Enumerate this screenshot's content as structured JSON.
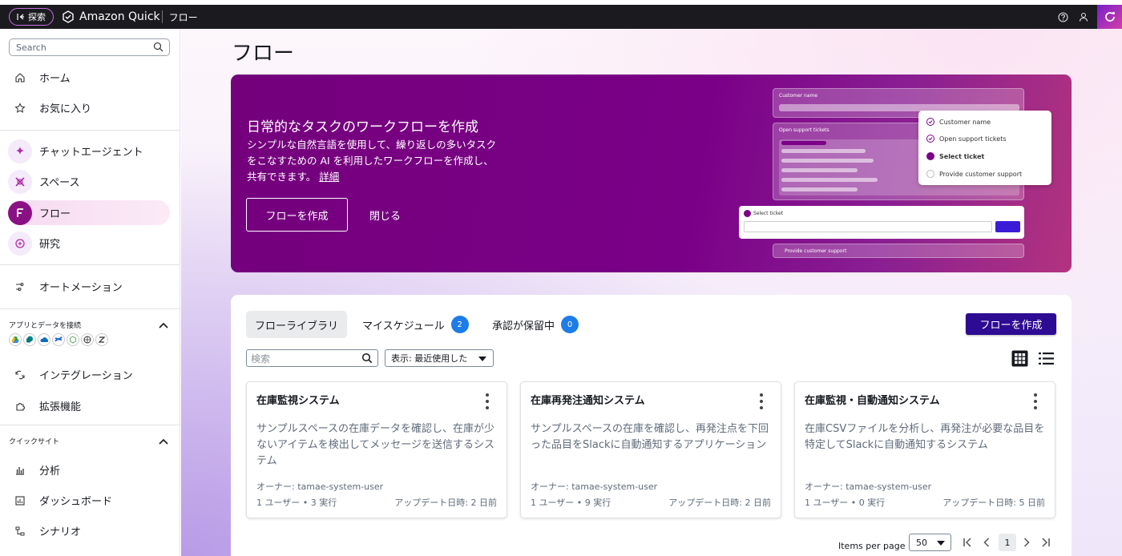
{
  "topbar": {
    "explore_label": "探索",
    "brand": "Amazon Quick",
    "breadcrumb": "フロー"
  },
  "sidebar": {
    "search_placeholder": "Search",
    "items": [
      {
        "label": "ホーム",
        "icon": "home-icon"
      },
      {
        "label": "お気に入り",
        "icon": "star-icon"
      },
      {
        "label": "チャットエージェント",
        "icon": "sparkle-icon"
      },
      {
        "label": "スペース",
        "icon": "spaces-icon"
      },
      {
        "label": "フロー",
        "icon": "flows-icon",
        "active": true
      },
      {
        "label": "研究",
        "icon": "research-icon"
      },
      {
        "label": "オートメーション",
        "icon": "automation-icon"
      },
      {
        "label": "インテグレーション",
        "icon": "integration-icon"
      },
      {
        "label": "拡張機能",
        "icon": "extension-icon"
      },
      {
        "label": "分析",
        "icon": "analysis-icon"
      },
      {
        "label": "ダッシュボード",
        "icon": "dashboard-icon"
      },
      {
        "label": "シナリオ",
        "icon": "scenario-icon"
      }
    ],
    "section_connect": "アプリとデータを接続",
    "section_quicksight": "クイックサイト"
  },
  "main": {
    "page_title": "フロー",
    "banner": {
      "title": "日常的なタスクのワークフローを作成",
      "line1": "シンプルな自然言語を使用して、繰り返しの多いタスク",
      "line2": "をこなすための AI を利用したワークフローを作成し、",
      "line3": "共有できます。",
      "link": "詳細",
      "create_label": "フローを作成",
      "close_label": "閉じる",
      "illustration": {
        "customer_name": "Customer name",
        "open_tickets": "Open support tickets",
        "select_ticket": "Select ticket",
        "provide_support": "Provide customer support",
        "select_ticket_card": "Select ticket",
        "provide_support_card": "Provide customer support"
      }
    },
    "library": {
      "tabs": [
        {
          "label": "フローライブラリ"
        },
        {
          "label": "マイスケジュール",
          "badge": "2"
        },
        {
          "label": "承認が保留中",
          "badge": "0"
        }
      ],
      "create_label": "フローを作成",
      "search_placeholder": "検索",
      "sort_label": "表示: 最近使用した",
      "cards": [
        {
          "title": "在庫監視システム",
          "desc": "サンプルスペースの在庫データを確認し、在庫が少ないアイテムを検出してメッセージを送信するシステム",
          "owner": "オーナー: tamae-system-user",
          "stats": "1 ユーザー • 3 実行",
          "updated": "アップデート日時: 2 日前"
        },
        {
          "title": "在庫再発注通知システム",
          "desc": "サンプルスペースの在庫を確認し、再発注点を下回った品目をSlackに自動通知するアプリケーション",
          "owner": "オーナー: tamae-system-user",
          "stats": "1 ユーザー • 9 実行",
          "updated": "アップデート日時: 2 日前"
        },
        {
          "title": "在庫監視・自動通知システム",
          "desc": "在庫CSVファイルを分析し、再発注が必要な品目を特定してSlackに自動通知するシステム",
          "owner": "オーナー: tamae-system-user",
          "stats": "1 ユーザー • 0 実行",
          "updated": "アップデート日時: 5 日前"
        }
      ],
      "pager": {
        "label": "Items per page",
        "per_page": "50",
        "current_page": "1"
      }
    }
  },
  "colors": {
    "banner_purple": "#74007c",
    "create_button": "#2e0b93",
    "badge_blue": "#1c7ce8"
  }
}
